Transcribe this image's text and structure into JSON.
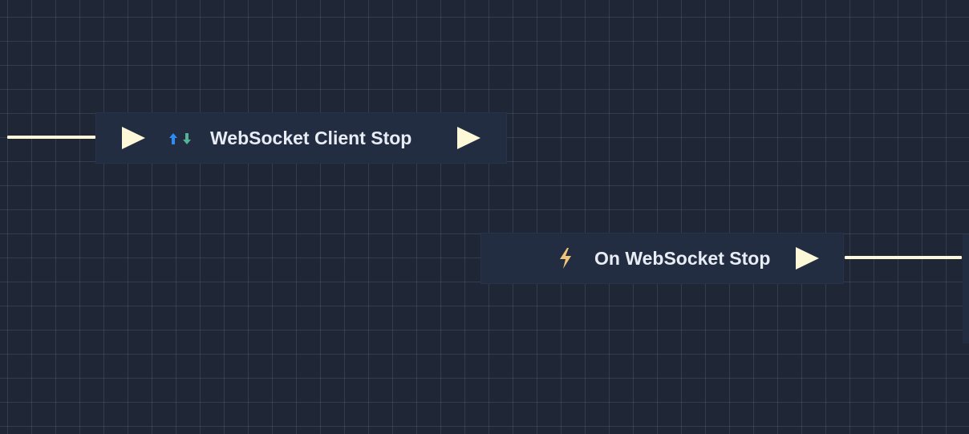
{
  "graph": {
    "nodes": [
      {
        "id": "websocket-client-stop",
        "title": "WebSocket Client Stop",
        "icon": "send-receive-arrows-icon",
        "inputs": [
          "exec"
        ],
        "outputs": [
          "exec"
        ]
      },
      {
        "id": "on-websocket-stop",
        "title": "On WebSocket Stop",
        "icon": "lightning-bolt-icon",
        "inputs": [],
        "outputs": [
          "exec"
        ]
      }
    ]
  },
  "colors": {
    "canvas_background": "#1f2636",
    "grid_line": "#34405a",
    "node_background": "#222d42",
    "exec_pin": "#fcf8d8",
    "wire": "#fcf8d8",
    "title_text": "#e8ecf4",
    "send_arrow": "#2f8cf0",
    "receive_arrow": "#53b394",
    "event_bolt": "#f0c47a"
  }
}
